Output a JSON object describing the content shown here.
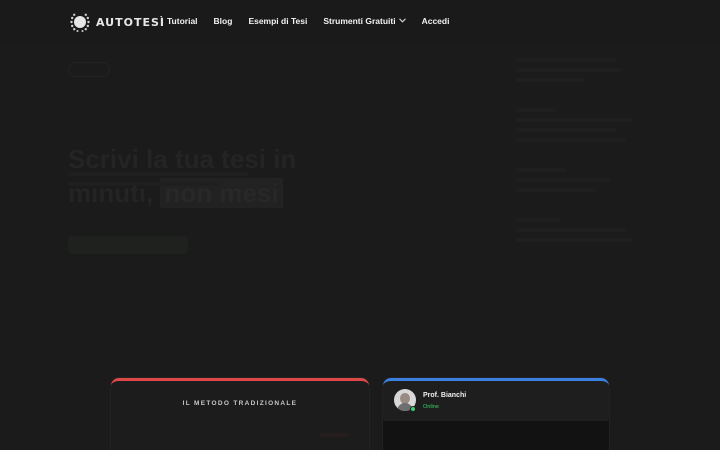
{
  "brand": {
    "name": "AUTOTESÌ"
  },
  "nav": {
    "items": [
      {
        "label": "Tutorial"
      },
      {
        "label": "Blog"
      },
      {
        "label": "Esempi di Tesi"
      },
      {
        "label": "Strumenti Gratuiti",
        "has_dropdown": true
      },
      {
        "label": "Accedi"
      }
    ]
  },
  "hero": {
    "headline_part1": "Scrivi la tua tesi in minuti,",
    "headline_highlight": "non mesi"
  },
  "cards": {
    "traditional": {
      "title": "IL METODO TRADIZIONALE"
    },
    "chat": {
      "name": "Prof. Bianchi",
      "status": "Online"
    }
  },
  "colors": {
    "background": "#1b1b1b",
    "traditional_accent": "#e04848",
    "chat_accent": "#3b7fe0",
    "online": "#3ad06a"
  }
}
